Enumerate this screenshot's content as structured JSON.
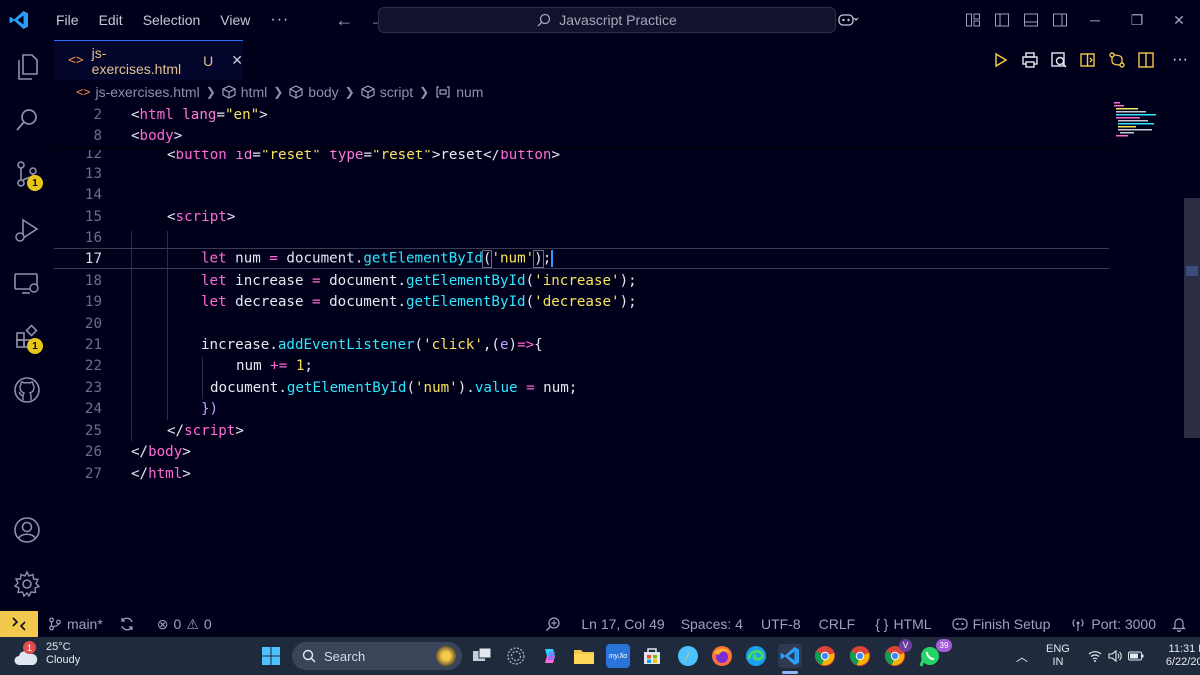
{
  "titlebar": {
    "menu": [
      "File",
      "Edit",
      "Selection",
      "View"
    ],
    "more": "···",
    "command_center": "Javascript Practice"
  },
  "activity": {
    "items": [
      {
        "name": "explorer-icon"
      },
      {
        "name": "search-icon"
      },
      {
        "name": "source-control-icon",
        "badge": "1"
      },
      {
        "name": "run-debug-icon"
      },
      {
        "name": "remote-explorer-icon"
      },
      {
        "name": "extensions-icon",
        "badge": "1"
      },
      {
        "name": "github-icon"
      }
    ],
    "bottom": [
      {
        "name": "account-icon"
      },
      {
        "name": "settings-gear-icon"
      }
    ]
  },
  "tab": {
    "name": "js-exercises.html",
    "status": "U",
    "close": "✕"
  },
  "breadcrumb": {
    "file": "js-exercises.html",
    "items": [
      "html",
      "body",
      "script",
      "num"
    ]
  },
  "editor": {
    "lines": [
      {
        "n": "2"
      },
      {
        "n": "8"
      },
      {
        "n": "12"
      },
      {
        "n": "13"
      },
      {
        "n": "14"
      },
      {
        "n": "15"
      },
      {
        "n": "16"
      },
      {
        "n": "17"
      },
      {
        "n": "18"
      },
      {
        "n": "19"
      },
      {
        "n": "20"
      },
      {
        "n": "21"
      },
      {
        "n": "22"
      },
      {
        "n": "23"
      },
      {
        "n": "24"
      },
      {
        "n": "25"
      },
      {
        "n": "26"
      },
      {
        "n": "27"
      }
    ],
    "t": {
      "l2_open": "<",
      "l2_tag": "html",
      "l2_attr": " lang",
      "l2_eq": "=",
      "l2_str": "\"en\"",
      "l2_close": ">",
      "l8_open": "<",
      "l8_tag": "body",
      "l8_close": ">",
      "l12_open": "<",
      "l12_tag": "button",
      "l12_a1": " id",
      "l12_eq1": "=",
      "l12_s1": "\"reset\"",
      "l12_a2": " type",
      "l12_eq2": "=",
      "l12_s2": "\"reset\"",
      "l12_gt": ">",
      "l12_text": "reset",
      "l12_cl": "</",
      "l12_ctag": "button",
      "l12_cgt": ">",
      "l15_open": "<",
      "l15_tag": "script",
      "l15_close": ">",
      "l17_kw": "let",
      "l17_id": " num ",
      "l17_op": "=",
      "l17_doc": " document.",
      "l17_fn": "getElementById",
      "l17_p1": "(",
      "l17_s": "'num'",
      "l17_p2": ")",
      "l17_semi": ";",
      "l18_kw": "let",
      "l18_id": " increase ",
      "l18_op": "=",
      "l18_doc": " document.",
      "l18_fn": "getElementById",
      "l18_p1": "(",
      "l18_s": "'increase'",
      "l18_p2": ");",
      "l19_kw": "let",
      "l19_id": " decrease ",
      "l19_op": "=",
      "l19_doc": " document.",
      "l19_fn": "getElementById",
      "l19_p1": "(",
      "l19_s": "'decrease'",
      "l19_p2": ");",
      "l21_id": "increase.",
      "l21_fn": "addEventListener",
      "l21_p1": "(",
      "l21_s": "'click'",
      "l21_c": ",(",
      "l21_pa": "e",
      "l21_p2": ")",
      "l21_ar": "=>",
      "l21_br": "{",
      "l22_id": "num ",
      "l22_op": "+=",
      "l22_sp": " ",
      "l22_nu": "1",
      "l22_semi": ";",
      "l23_doc": "document.",
      "l23_fn": "getElementById",
      "l23_p1": "(",
      "l23_s": "'num'",
      "l23_p2": ").",
      "l23_pr": "value",
      "l23_sp": " ",
      "l23_op": "=",
      "l23_rest": " num;",
      "l24_text": "})",
      "l25_open": "</",
      "l25_tag": "script",
      "l25_close": ">",
      "l26_open": "</",
      "l26_tag": "body",
      "l26_close": ">",
      "l27_open": "</",
      "l27_tag": "html",
      "l27_close": ">"
    }
  },
  "statusbar": {
    "branch": "main*",
    "errors": "0",
    "warnings": "0",
    "position": "Ln 17, Col 49",
    "spaces": "Spaces: 4",
    "encoding": "UTF-8",
    "eol": "CRLF",
    "language": "HTML",
    "language_icon": "{ }",
    "finish_setup": "Finish Setup",
    "port": "Port: 3000"
  },
  "taskbar": {
    "weather_temp": "25°C",
    "weather_desc": "Cloudy",
    "weather_badge": "1",
    "search": "Search",
    "lang1": "ENG",
    "lang2": "IN",
    "time": "11:31 PM",
    "date": "6/22/2025",
    "whatsapp_badge": "39",
    "profile_letter": "V"
  },
  "colors": {
    "background": "#00001a",
    "accent_blue": "#2b6cff",
    "keyword": "#ff6ad5",
    "function": "#2ee6ff",
    "string": "#f8e45c",
    "badge": "#e8c51a"
  }
}
